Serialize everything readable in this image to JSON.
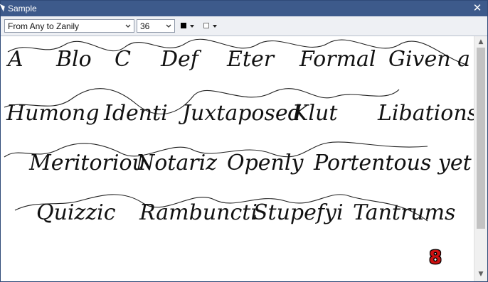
{
  "window": {
    "title": "Sample"
  },
  "toolbar": {
    "sample_text_selection": "From Any to Zanily",
    "font_size": "36",
    "foreground_color": "#000000",
    "background_color": "#ffffff"
  },
  "sample_lines": [
    [
      "A",
      "Blo",
      "C",
      "Def",
      "Eter",
      "Formal",
      "Given a"
    ],
    [
      "Humong",
      "Identi",
      "Juxtaposed",
      "Klut",
      "Libations"
    ],
    [
      "Meritoriou",
      "Notariz",
      "Openly",
      "Portentous yet"
    ],
    [
      "Quizzic",
      "Rambuncti",
      "Stupefyi",
      "Tantrums"
    ]
  ],
  "badge": {
    "label": "8",
    "color": "#cc1111"
  },
  "icons": {
    "close": "close-icon",
    "dropdown": "chevron-down-icon",
    "scroll_up": "scroll-up-arrow-icon",
    "scroll_down": "scroll-down-arrow-icon"
  }
}
